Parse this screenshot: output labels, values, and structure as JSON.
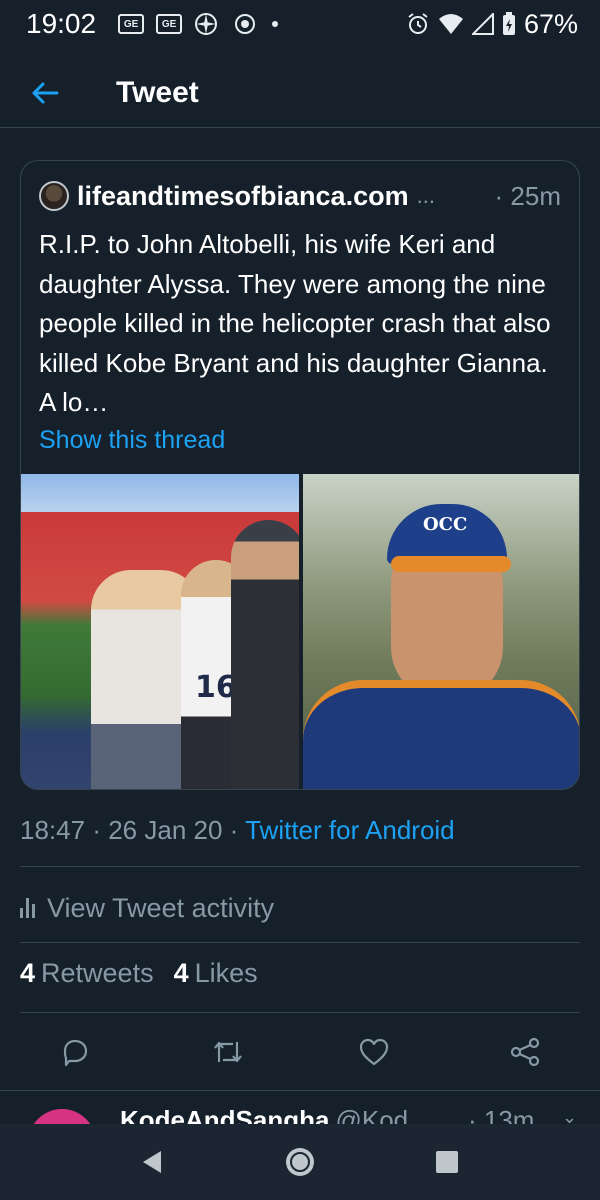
{
  "status_bar": {
    "time": "19:02",
    "battery": "67%",
    "left_icons": [
      "ge-icon",
      "ge-icon",
      "pinwheel-icon",
      "abc13-icon",
      "dot-icon"
    ],
    "ge_label": "GE",
    "right_icons": [
      "alarm-icon",
      "wifi-icon",
      "signal-icon",
      "battery-icon"
    ]
  },
  "app_bar": {
    "title": "Tweet"
  },
  "tweet": {
    "author": "lifeandtimesofbianca.com",
    "overflow": "...",
    "time_ago": "· 25m",
    "text": "R.I.P. to John Altobelli, his wife Keri and daughter Alyssa. They were among the nine people killed in the helicopter crash that also killed Kobe Bryant and his daughter Gianna. A lo…",
    "thread_link": "Show this thread",
    "photo_jersey_number": "16",
    "photo_cap_logo": "OCC"
  },
  "meta": {
    "time": "18:47",
    "date": "26 Jan 20",
    "sep": "·",
    "source": "Twitter for Android"
  },
  "activity": {
    "label": "View Tweet activity"
  },
  "stats": {
    "retweets_count": "4",
    "retweets_label": "Retweets",
    "likes_count": "4",
    "likes_label": "Likes"
  },
  "reply_preview": {
    "name": "KodeAndSangha",
    "handle": "@Kod",
    "time_ago": "· 13m"
  },
  "colors": {
    "background": "#15202b",
    "accent": "#1da1f2",
    "secondary_text": "#8899a6",
    "border": "#38444d"
  }
}
